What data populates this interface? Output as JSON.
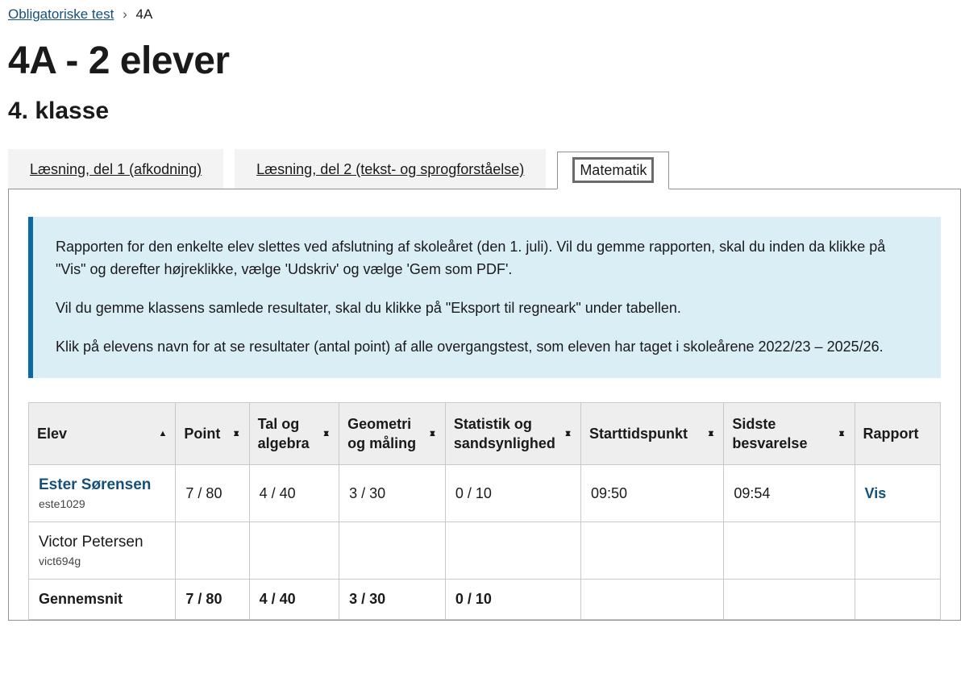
{
  "breadcrumb": {
    "parent": "Obligatoriske test",
    "current": "4A"
  },
  "page_title": "4A - 2 elever",
  "sub_title": "4. klasse",
  "tabs": {
    "items": [
      {
        "label": "Læsning, del 1 (afkodning)",
        "active": false
      },
      {
        "label": "Læsning, del 2 (tekst- og sprogforståelse)",
        "active": false
      },
      {
        "label": "Matematik",
        "active": true
      }
    ]
  },
  "info": {
    "p1": "Rapporten for den enkelte elev slettes ved afslutning af skoleåret (den 1. juli). Vil du gemme rapporten, skal du inden da klikke på \"Vis\" og derefter højreklikke, vælge 'Udskriv' og vælge 'Gem som PDF'.",
    "p2": "Vil du gemme klassens samlede resultater, skal du klikke på \"Eksport til regneark\" under tabellen.",
    "p3": "Klik på elevens navn for at se resultater (antal point) af alle overgangstest, som eleven har taget i skoleårene 2022/23 – 2025/26."
  },
  "table": {
    "headers": {
      "elev": "Elev",
      "point": "Point",
      "tal": "Tal og algebra",
      "geometri": "Geometri og måling",
      "statistik": "Statistik og sandsynlighed",
      "start": "Starttidspunkt",
      "sidste": "Sidste besvarelse",
      "rapport": "Rapport"
    },
    "rows": [
      {
        "name": "Ester Sørensen",
        "uid": "este1029",
        "link": true,
        "point": "7 / 80",
        "tal": "4 / 40",
        "geometri": "3 / 30",
        "statistik": "0 / 10",
        "start": "09:50",
        "sidste": "09:54",
        "rapport": "Vis"
      },
      {
        "name": "Victor Petersen",
        "uid": "vict694g",
        "link": false,
        "point": "",
        "tal": "",
        "geometri": "",
        "statistik": "",
        "start": "",
        "sidste": "",
        "rapport": ""
      }
    ],
    "avg": {
      "label": "Gennemsnit",
      "point": "7 / 80",
      "tal": "4 / 40",
      "geometri": "3 / 30",
      "statistik": "0 / 10"
    }
  }
}
